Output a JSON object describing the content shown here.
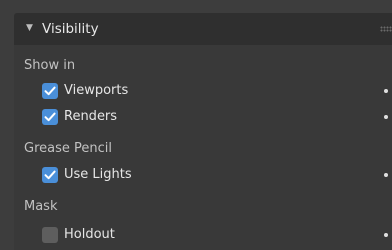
{
  "panel": {
    "title": "Visibility",
    "expanded": true
  },
  "sections": {
    "show_in": {
      "label": "Show in",
      "items": [
        {
          "label": "Viewports",
          "checked": true
        },
        {
          "label": "Renders",
          "checked": true
        }
      ]
    },
    "grease_pencil": {
      "label": "Grease Pencil",
      "items": [
        {
          "label": "Use Lights",
          "checked": true
        }
      ]
    },
    "mask": {
      "label": "Mask",
      "items": [
        {
          "label": "Holdout",
          "checked": false
        }
      ]
    }
  },
  "colors": {
    "checkbox_on": "#4a8fd9",
    "checkbox_off": "#5e5e5e"
  }
}
